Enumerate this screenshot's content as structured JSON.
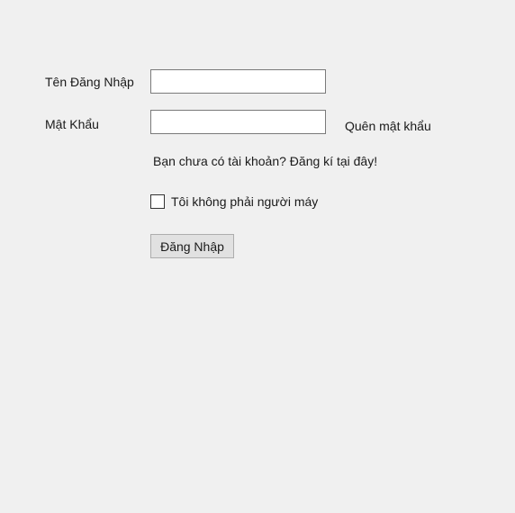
{
  "form": {
    "username_label": "Tên Đăng Nhập",
    "username_value": "",
    "password_label": "Mật Khẩu",
    "password_value": "",
    "forgot_password_link": "Quên mật khẩu",
    "register_link": "Bạn chưa có tài khoản? Đăng kí tại đây!",
    "captcha_checkbox_label": "Tôi không phải người máy",
    "captcha_checked": false,
    "login_button_label": "Đăng Nhập"
  }
}
